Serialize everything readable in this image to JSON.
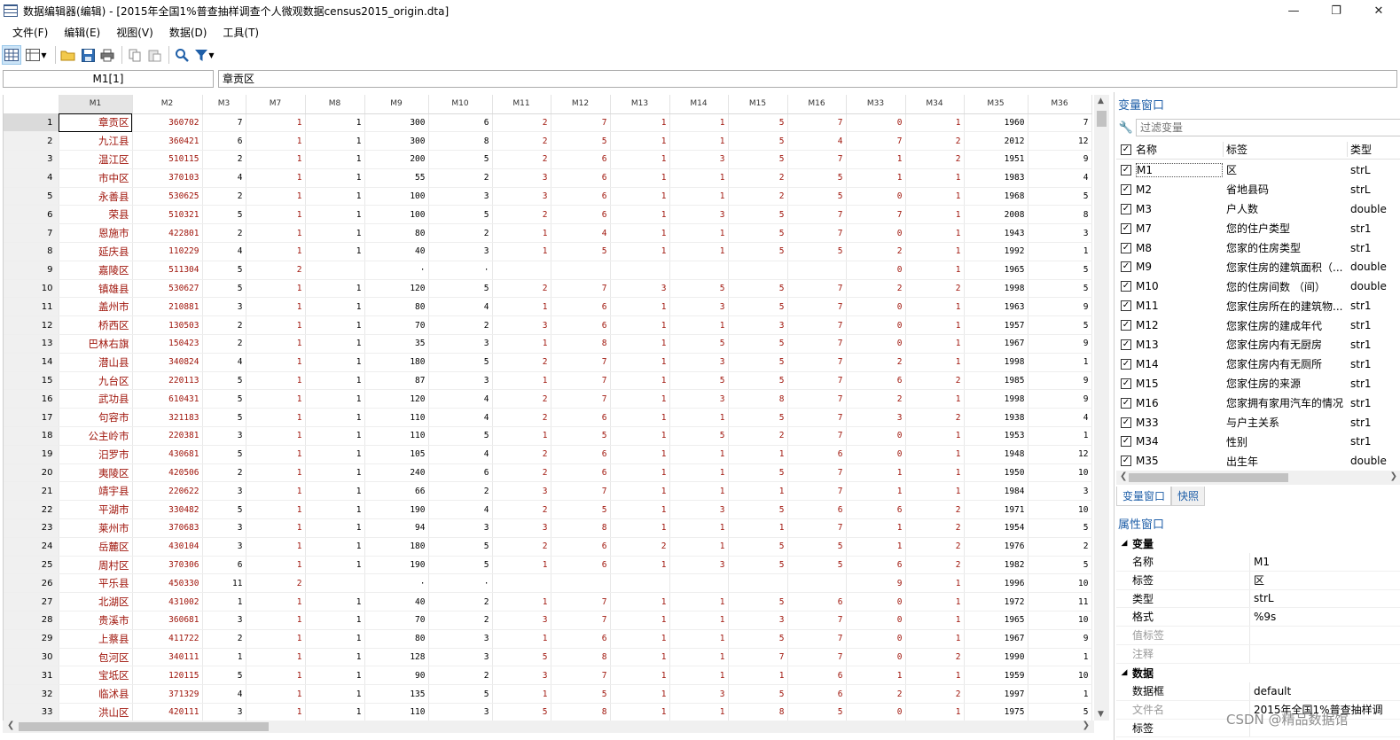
{
  "window": {
    "title": "数据编辑器(编辑) - [2015年全国1%普查抽样调查个人微观数据census2015_origin.dta]",
    "minimize": "—",
    "restore": "❐",
    "close": "✕"
  },
  "menu": [
    "文件(F)",
    "编辑(E)",
    "视图(V)",
    "数据(D)",
    "工具(T)"
  ],
  "toolbar": {
    "icons": [
      "grid-view-icon",
      "grid-options-icon",
      "open-folder-icon",
      "save-icon",
      "print-icon",
      "copy-icon",
      "paste-icon",
      "search-icon",
      "filter-icon"
    ]
  },
  "cellref": "M1[1]",
  "cellvalue": "章贡区",
  "grid": {
    "columns": [
      "M1",
      "M2",
      "M3",
      "M7",
      "M8",
      "M9",
      "M10",
      "M11",
      "M12",
      "M13",
      "M14",
      "M15",
      "M16",
      "M33",
      "M34",
      "M35",
      "M36"
    ],
    "rows": [
      [
        "1",
        "章贡区",
        "360702",
        "7",
        "1",
        "1",
        "300",
        "6",
        "2",
        "7",
        "1",
        "1",
        "5",
        "7",
        "0",
        "1",
        "1960",
        "7"
      ],
      [
        "2",
        "九江县",
        "360421",
        "6",
        "1",
        "1",
        "300",
        "8",
        "2",
        "5",
        "1",
        "1",
        "5",
        "4",
        "7",
        "2",
        "2012",
        "12"
      ],
      [
        "3",
        "温江区",
        "510115",
        "2",
        "1",
        "1",
        "200",
        "5",
        "2",
        "6",
        "1",
        "3",
        "5",
        "7",
        "1",
        "2",
        "1951",
        "9"
      ],
      [
        "4",
        "市中区",
        "370103",
        "4",
        "1",
        "1",
        "55",
        "2",
        "3",
        "6",
        "1",
        "1",
        "2",
        "5",
        "1",
        "1",
        "1983",
        "4"
      ],
      [
        "5",
        "永善县",
        "530625",
        "2",
        "1",
        "1",
        "100",
        "3",
        "3",
        "6",
        "1",
        "1",
        "2",
        "5",
        "0",
        "1",
        "1968",
        "5"
      ],
      [
        "6",
        "荣县",
        "510321",
        "5",
        "1",
        "1",
        "100",
        "5",
        "2",
        "6",
        "1",
        "3",
        "5",
        "7",
        "7",
        "1",
        "2008",
        "8"
      ],
      [
        "7",
        "恩施市",
        "422801",
        "2",
        "1",
        "1",
        "80",
        "2",
        "1",
        "4",
        "1",
        "1",
        "5",
        "7",
        "0",
        "1",
        "1943",
        "3"
      ],
      [
        "8",
        "延庆县",
        "110229",
        "4",
        "1",
        "1",
        "40",
        "3",
        "1",
        "5",
        "1",
        "1",
        "5",
        "5",
        "2",
        "1",
        "1992",
        "1"
      ],
      [
        "9",
        "嘉陵区",
        "511304",
        "5",
        "2",
        "",
        "·",
        "·",
        "",
        "",
        "",
        "",
        "",
        "",
        "0",
        "1",
        "1965",
        "5"
      ],
      [
        "10",
        "镇雄县",
        "530627",
        "5",
        "1",
        "1",
        "120",
        "5",
        "2",
        "7",
        "3",
        "5",
        "5",
        "7",
        "2",
        "2",
        "1998",
        "5"
      ],
      [
        "11",
        "盖州市",
        "210881",
        "3",
        "1",
        "1",
        "80",
        "4",
        "1",
        "6",
        "1",
        "3",
        "5",
        "7",
        "0",
        "1",
        "1963",
        "9"
      ],
      [
        "12",
        "桥西区",
        "130503",
        "2",
        "1",
        "1",
        "70",
        "2",
        "3",
        "6",
        "1",
        "1",
        "3",
        "7",
        "0",
        "1",
        "1957",
        "5"
      ],
      [
        "13",
        "巴林右旗",
        "150423",
        "2",
        "1",
        "1",
        "35",
        "3",
        "1",
        "8",
        "1",
        "5",
        "5",
        "7",
        "0",
        "1",
        "1967",
        "9"
      ],
      [
        "14",
        "潜山县",
        "340824",
        "4",
        "1",
        "1",
        "180",
        "5",
        "2",
        "7",
        "1",
        "3",
        "5",
        "7",
        "2",
        "1",
        "1998",
        "1"
      ],
      [
        "15",
        "九台区",
        "220113",
        "5",
        "1",
        "1",
        "87",
        "3",
        "1",
        "7",
        "1",
        "5",
        "5",
        "7",
        "6",
        "2",
        "1985",
        "9"
      ],
      [
        "16",
        "武功县",
        "610431",
        "5",
        "1",
        "1",
        "120",
        "4",
        "2",
        "7",
        "1",
        "3",
        "8",
        "7",
        "2",
        "1",
        "1998",
        "9"
      ],
      [
        "17",
        "句容市",
        "321183",
        "5",
        "1",
        "1",
        "110",
        "4",
        "2",
        "6",
        "1",
        "1",
        "5",
        "7",
        "3",
        "2",
        "1938",
        "4"
      ],
      [
        "18",
        "公主岭市",
        "220381",
        "3",
        "1",
        "1",
        "110",
        "5",
        "1",
        "5",
        "1",
        "5",
        "2",
        "7",
        "0",
        "1",
        "1953",
        "1"
      ],
      [
        "19",
        "汨罗市",
        "430681",
        "5",
        "1",
        "1",
        "105",
        "4",
        "2",
        "6",
        "1",
        "1",
        "1",
        "6",
        "0",
        "1",
        "1948",
        "12"
      ],
      [
        "20",
        "夷陵区",
        "420506",
        "2",
        "1",
        "1",
        "240",
        "6",
        "2",
        "6",
        "1",
        "1",
        "5",
        "7",
        "1",
        "1",
        "1950",
        "10"
      ],
      [
        "21",
        "靖宇县",
        "220622",
        "3",
        "1",
        "1",
        "66",
        "2",
        "3",
        "7",
        "1",
        "1",
        "1",
        "7",
        "1",
        "1",
        "1984",
        "3"
      ],
      [
        "22",
        "平湖市",
        "330482",
        "5",
        "1",
        "1",
        "190",
        "4",
        "2",
        "5",
        "1",
        "3",
        "5",
        "6",
        "6",
        "2",
        "1971",
        "10"
      ],
      [
        "23",
        "莱州市",
        "370683",
        "3",
        "1",
        "1",
        "94",
        "3",
        "3",
        "8",
        "1",
        "1",
        "1",
        "7",
        "1",
        "2",
        "1954",
        "5"
      ],
      [
        "24",
        "岳麓区",
        "430104",
        "3",
        "1",
        "1",
        "180",
        "5",
        "2",
        "6",
        "2",
        "1",
        "5",
        "5",
        "1",
        "2",
        "1976",
        "2"
      ],
      [
        "25",
        "周村区",
        "370306",
        "6",
        "1",
        "1",
        "190",
        "5",
        "1",
        "6",
        "1",
        "3",
        "5",
        "5",
        "6",
        "2",
        "1982",
        "5"
      ],
      [
        "26",
        "平乐县",
        "450330",
        "11",
        "2",
        "",
        "·",
        "·",
        "",
        "",
        "",
        "",
        "",
        "",
        "9",
        "1",
        "1996",
        "10"
      ],
      [
        "27",
        "北湖区",
        "431002",
        "1",
        "1",
        "1",
        "40",
        "2",
        "1",
        "7",
        "1",
        "1",
        "5",
        "6",
        "0",
        "1",
        "1972",
        "11"
      ],
      [
        "28",
        "贵溪市",
        "360681",
        "3",
        "1",
        "1",
        "70",
        "2",
        "3",
        "7",
        "1",
        "1",
        "3",
        "7",
        "0",
        "1",
        "1965",
        "10"
      ],
      [
        "29",
        "上蔡县",
        "411722",
        "2",
        "1",
        "1",
        "80",
        "3",
        "1",
        "6",
        "1",
        "1",
        "5",
        "7",
        "0",
        "1",
        "1967",
        "9"
      ],
      [
        "30",
        "包河区",
        "340111",
        "1",
        "1",
        "1",
        "128",
        "3",
        "5",
        "8",
        "1",
        "1",
        "7",
        "7",
        "0",
        "2",
        "1990",
        "1"
      ],
      [
        "31",
        "宝坻区",
        "120115",
        "5",
        "1",
        "1",
        "90",
        "2",
        "3",
        "7",
        "1",
        "1",
        "1",
        "6",
        "1",
        "1",
        "1959",
        "10"
      ],
      [
        "32",
        "临沭县",
        "371329",
        "4",
        "1",
        "1",
        "135",
        "5",
        "1",
        "5",
        "1",
        "3",
        "5",
        "6",
        "2",
        "2",
        "1997",
        "1"
      ],
      [
        "33",
        "洪山区",
        "420111",
        "3",
        "1",
        "1",
        "110",
        "3",
        "5",
        "8",
        "1",
        "1",
        "8",
        "5",
        "0",
        "1",
        "1975",
        "5"
      ]
    ]
  },
  "varpanel": {
    "title": "变量窗口",
    "filter_placeholder": "过滤变量",
    "headers": {
      "name": "名称",
      "label": "标签",
      "type": "类型"
    },
    "vars": [
      {
        "name": "M1",
        "label": "区",
        "type": "strL"
      },
      {
        "name": "M2",
        "label": "省地县码",
        "type": "strL"
      },
      {
        "name": "M3",
        "label": "户人数",
        "type": "double"
      },
      {
        "name": "M7",
        "label": "您的住户类型",
        "type": "str1"
      },
      {
        "name": "M8",
        "label": "您家的住房类型",
        "type": "str1"
      },
      {
        "name": "M9",
        "label": "您家住房的建筑面积（...",
        "type": "double"
      },
      {
        "name": "M10",
        "label": "您的住房间数 （间）",
        "type": "double"
      },
      {
        "name": "M11",
        "label": "您家住房所在的建筑物...",
        "type": "str1"
      },
      {
        "name": "M12",
        "label": "您家住房的建成年代",
        "type": "str1"
      },
      {
        "name": "M13",
        "label": "您家住房内有无厨房",
        "type": "str1"
      },
      {
        "name": "M14",
        "label": "您家住房内有无厕所",
        "type": "str1"
      },
      {
        "name": "M15",
        "label": "您家住房的来源",
        "type": "str1"
      },
      {
        "name": "M16",
        "label": "您家拥有家用汽车的情况",
        "type": "str1"
      },
      {
        "name": "M33",
        "label": "与户主关系",
        "type": "str1"
      },
      {
        "name": "M34",
        "label": "性别",
        "type": "str1"
      },
      {
        "name": "M35",
        "label": "出生年",
        "type": "double"
      }
    ],
    "tabs": [
      "变量窗口",
      "快照"
    ]
  },
  "propertypanel": {
    "title": "属性窗口",
    "section_var": "变量",
    "var_props": [
      {
        "key": "名称",
        "value": "M1"
      },
      {
        "key": "标签",
        "value": "区"
      },
      {
        "key": "类型",
        "value": "strL"
      },
      {
        "key": "格式",
        "value": "%9s"
      },
      {
        "key": "值标签",
        "value": ""
      },
      {
        "key": "注释",
        "value": ""
      }
    ],
    "section_data": "数据",
    "data_props": [
      {
        "key": "数据框",
        "value": "default"
      },
      {
        "key": "文件名",
        "value": "2015年全国1%普查抽样调"
      },
      {
        "key": "标签",
        "value": ""
      }
    ]
  },
  "watermark": "CSDN @精品数据馆",
  "colors": {
    "accent": "#1f5fa8",
    "string_value": "#a0160c"
  }
}
